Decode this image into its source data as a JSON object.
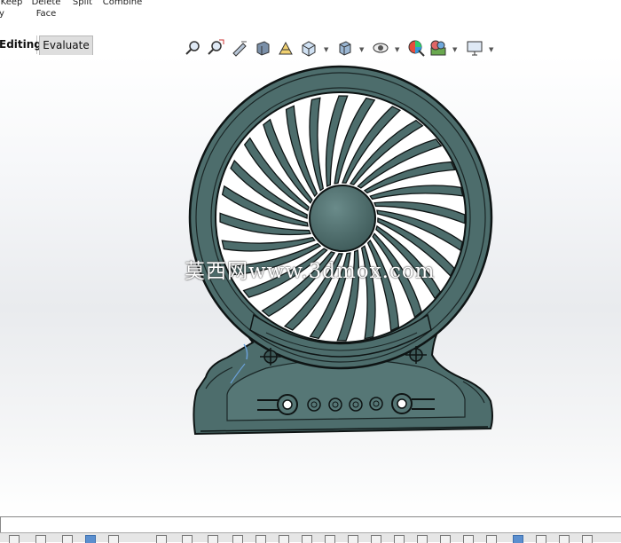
{
  "ribbon": {
    "commands": [
      {
        "id": "keep-body",
        "lines": [
          "Keep",
          "y"
        ]
      },
      {
        "id": "delete-face",
        "lines": [
          "Delete",
          "Face"
        ]
      },
      {
        "id": "split",
        "lines": [
          "Split"
        ]
      },
      {
        "id": "combine",
        "lines": [
          "Combine"
        ]
      }
    ]
  },
  "tabs": [
    {
      "label": "Editing",
      "active": false
    },
    {
      "label": "Evaluate",
      "active": true
    }
  ],
  "heads_up_toolbar": {
    "icons": [
      "zoom-to-fit-icon",
      "zoom-to-area-icon",
      "previous-view-icon",
      "section-view-icon",
      "dynamic-annotation-view-icon",
      "view-orientation-icon",
      "display-style-icon",
      "hide-show-items-icon",
      "edit-appearance-icon",
      "apply-scene-icon",
      "view-settings-icon"
    ]
  },
  "viewport": {
    "watermark": "莫西网www.3dmox.com",
    "model": "desk-fan-model"
  },
  "colors": {
    "model_fill": "#4d6d6c",
    "model_edge": "#0e1414",
    "viewport_mid": "#e9ebee",
    "active_tab": "#dedede"
  }
}
